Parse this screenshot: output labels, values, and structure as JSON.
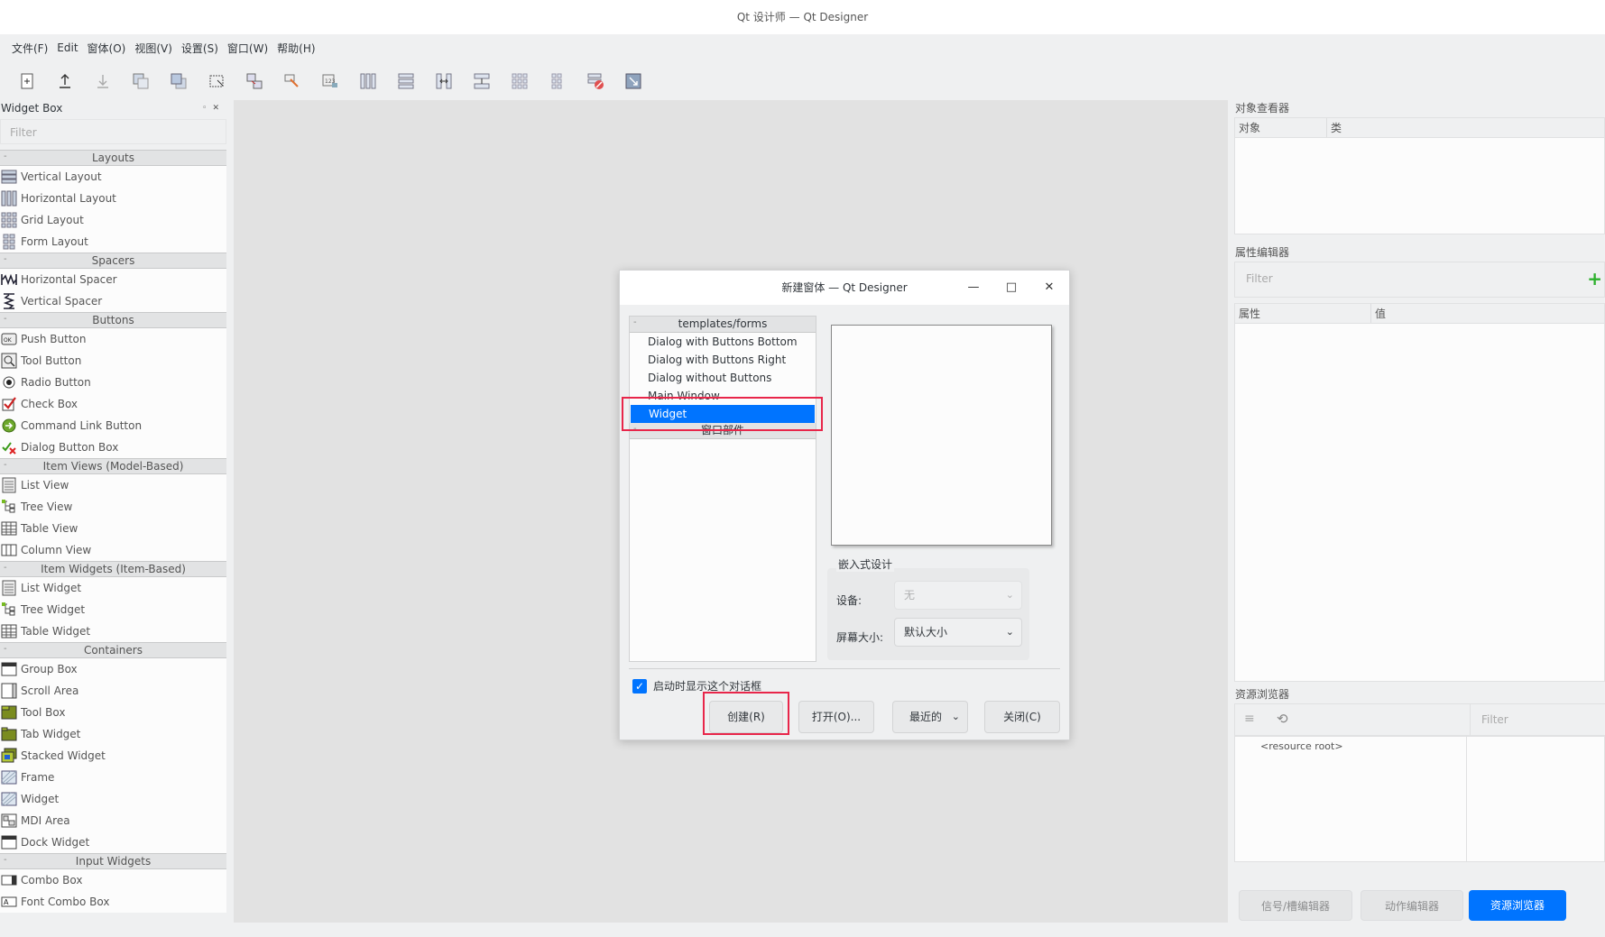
{
  "window": {
    "title": "Qt 设计师 — Qt Designer"
  },
  "menu": [
    "文件(F)",
    "Edit",
    "窗体(O)",
    "视图(V)",
    "设置(S)",
    "窗口(W)",
    "帮助(H)"
  ],
  "widget_box": {
    "title": "Widget Box",
    "filter_placeholder": "Filter",
    "categories": [
      {
        "name": "Layouts",
        "items": [
          {
            "label": "Vertical Layout",
            "icon": "vertical-layout-icon"
          },
          {
            "label": "Horizontal Layout",
            "icon": "horizontal-layout-icon"
          },
          {
            "label": "Grid Layout",
            "icon": "grid-layout-icon"
          },
          {
            "label": "Form Layout",
            "icon": "form-layout-icon"
          }
        ]
      },
      {
        "name": "Spacers",
        "items": [
          {
            "label": "Horizontal Spacer",
            "icon": "horizontal-spacer-icon"
          },
          {
            "label": "Vertical Spacer",
            "icon": "vertical-spacer-icon"
          }
        ]
      },
      {
        "name": "Buttons",
        "items": [
          {
            "label": "Push Button",
            "icon": "push-button-icon"
          },
          {
            "label": "Tool Button",
            "icon": "tool-button-icon"
          },
          {
            "label": "Radio Button",
            "icon": "radio-button-icon"
          },
          {
            "label": "Check Box",
            "icon": "check-box-icon"
          },
          {
            "label": "Command Link Button",
            "icon": "command-link-icon"
          },
          {
            "label": "Dialog Button Box",
            "icon": "dialog-button-box-icon"
          }
        ]
      },
      {
        "name": "Item Views (Model-Based)",
        "items": [
          {
            "label": "List View",
            "icon": "list-view-icon"
          },
          {
            "label": "Tree View",
            "icon": "tree-view-icon"
          },
          {
            "label": "Table View",
            "icon": "table-view-icon"
          },
          {
            "label": "Column View",
            "icon": "column-view-icon"
          }
        ]
      },
      {
        "name": "Item Widgets (Item-Based)",
        "items": [
          {
            "label": "List Widget",
            "icon": "list-widget-icon"
          },
          {
            "label": "Tree Widget",
            "icon": "tree-widget-icon"
          },
          {
            "label": "Table Widget",
            "icon": "table-widget-icon"
          }
        ]
      },
      {
        "name": "Containers",
        "items": [
          {
            "label": "Group Box",
            "icon": "group-box-icon"
          },
          {
            "label": "Scroll Area",
            "icon": "scroll-area-icon"
          },
          {
            "label": "Tool Box",
            "icon": "tool-box-icon"
          },
          {
            "label": "Tab Widget",
            "icon": "tab-widget-icon"
          },
          {
            "label": "Stacked Widget",
            "icon": "stacked-widget-icon"
          },
          {
            "label": "Frame",
            "icon": "frame-icon"
          },
          {
            "label": "Widget",
            "icon": "widget-icon"
          },
          {
            "label": "MDI Area",
            "icon": "mdi-area-icon"
          },
          {
            "label": "Dock Widget",
            "icon": "dock-widget-icon"
          }
        ]
      },
      {
        "name": "Input Widgets",
        "items": [
          {
            "label": "Combo Box",
            "icon": "combo-box-icon"
          },
          {
            "label": "Font Combo Box",
            "icon": "font-combo-box-icon"
          }
        ]
      }
    ]
  },
  "object_inspector": {
    "title": "对象查看器",
    "col_object": "对象",
    "col_class": "类"
  },
  "property_editor": {
    "title": "属性编辑器",
    "filter_placeholder": "Filter",
    "col_property": "属性",
    "col_value": "值"
  },
  "resource_browser": {
    "title": "资源浏览器",
    "filter_placeholder": "Filter",
    "root": "<resource root>"
  },
  "bottom_tabs": [
    "信号/槽编辑器",
    "动作编辑器",
    "资源浏览器"
  ],
  "dialog": {
    "title": "新建窗体 — Qt Designer",
    "tree_header": "templates/forms",
    "templates": [
      "Dialog with Buttons Bottom",
      "Dialog with Buttons Right",
      "Dialog without Buttons",
      "Main Window",
      "Widget"
    ],
    "selected_template": "Widget",
    "second_header": "窗口部件",
    "embedded_title": "嵌入式设计",
    "device_label": "设备:",
    "device_value": "无",
    "screen_size_label": "屏幕大小:",
    "screen_size_value": "默认大小",
    "show_on_startup": "启动时显示这个对话框",
    "buttons": {
      "create": "创建(R)",
      "open": "打开(O)...",
      "recent": "最近的",
      "close": "关闭(C)"
    }
  },
  "colors": {
    "accent": "#0074ff",
    "highlight_box": "#e8264a"
  }
}
